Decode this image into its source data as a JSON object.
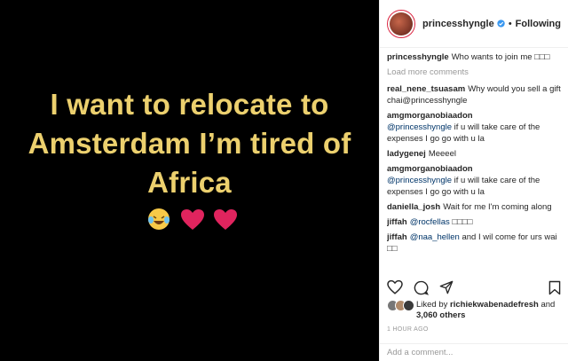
{
  "post": {
    "image_text": [
      "I want to relocate to",
      "Amsterdam I’m tired of",
      "Africa"
    ]
  },
  "header": {
    "username": "princesshyngle",
    "separator": "•",
    "follow_label": "Following"
  },
  "comments": {
    "caption": {
      "user": "princesshyngle",
      "text": "Who wants to join me □□□"
    },
    "load_more": "Load more comments",
    "items": [
      {
        "user": "real_nene_tsuasam",
        "text": "Why would you sell a gift chai@princesshyngle"
      },
      {
        "user": "amgmorganobiaadon",
        "mention": "@princesshyngle",
        "text": "if u will take care of the expenses I go go with u la"
      },
      {
        "user": "ladygenej",
        "text": "Meeeel"
      },
      {
        "user": "amgmorganobiaadon",
        "mention": "@princesshyngle",
        "text": "if u will take care of the expenses I go go with u la"
      },
      {
        "user": "daniella_josh",
        "text": "Wait for me I'm coming along"
      },
      {
        "user": "jiffah",
        "mention": "@rocfellas",
        "text": "□□□□"
      },
      {
        "user": "jiffah",
        "mention": "@naa_hellen",
        "text": "and I wil come for urs wai □□"
      }
    ]
  },
  "likes": {
    "prefix": "Liked by",
    "user": "richiekwabenadefresh",
    "and": "and",
    "others": "3,060 others"
  },
  "timestamp": "1 HOUR AGO",
  "add_comment": {
    "placeholder": "Add a comment..."
  },
  "colors": {
    "media_bg": "#000000",
    "media_text": "#ecd06e",
    "verified": "#3897f0",
    "heart": "#e0245e"
  }
}
